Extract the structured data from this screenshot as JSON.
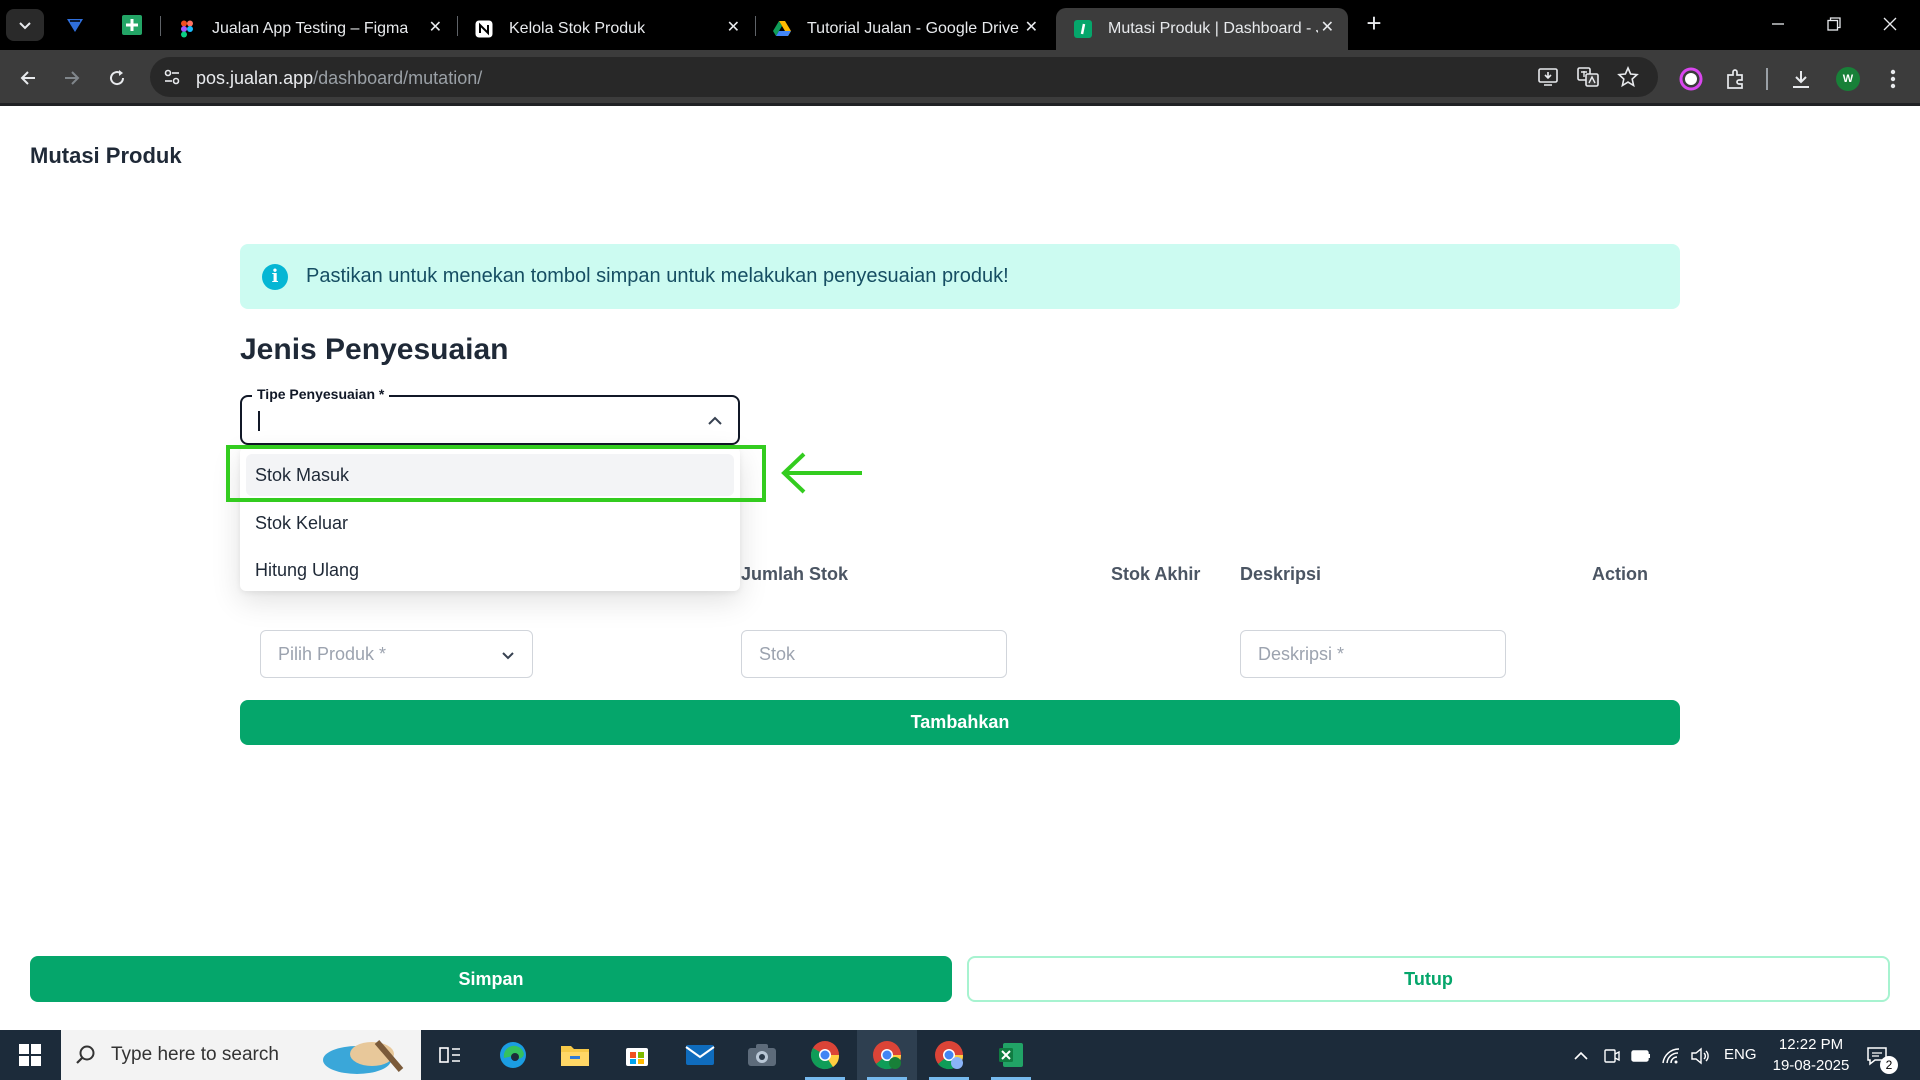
{
  "browser": {
    "tabs": [
      {
        "title": "Jualan App Testing – Figma",
        "favicon": "figma-icon"
      },
      {
        "title": "Kelola Stok Produk",
        "favicon": "notion-icon"
      },
      {
        "title": "Tutorial Jualan - Google Drive",
        "favicon": "google-drive-icon"
      },
      {
        "title": "Mutasi Produk | Dashboard - Ju",
        "favicon": "jualan-icon",
        "active": true
      }
    ],
    "url_host": "pos.jualan.app",
    "url_path": "/dashboard/mutation/",
    "profile_initial": "W"
  },
  "page": {
    "title": "Mutasi Produk",
    "alert": "Pastikan untuk menekan tombol simpan untuk melakukan penyesuaian produk!",
    "section_title": "Jenis Penyesuaian",
    "select": {
      "label": "Tipe Penyesuaian *",
      "value": ""
    },
    "dropdown_options": [
      "Stok Masuk",
      "Stok Keluar",
      "Hitung Ulang"
    ],
    "highlighted_option": "Stok Masuk",
    "columns": [
      "Jumlah Stok",
      "Stok Akhir",
      "Deskripsi",
      "Action"
    ],
    "inputs": {
      "product_placeholder": "Pilih Produk *",
      "stock_placeholder": "Stok",
      "description_placeholder": "Deskripsi *"
    },
    "add_button": "Tambahkan",
    "save_button": "Simpan",
    "close_button": "Tutup",
    "colors": {
      "primary": "#05a66b",
      "alert_bg": "#ccfbf1",
      "annotation": "#33cc1f"
    }
  },
  "taskbar": {
    "search_placeholder": "Type here to search",
    "language": "ENG",
    "time": "12:22 PM",
    "date": "19-08-2025",
    "notification_count": "2"
  }
}
